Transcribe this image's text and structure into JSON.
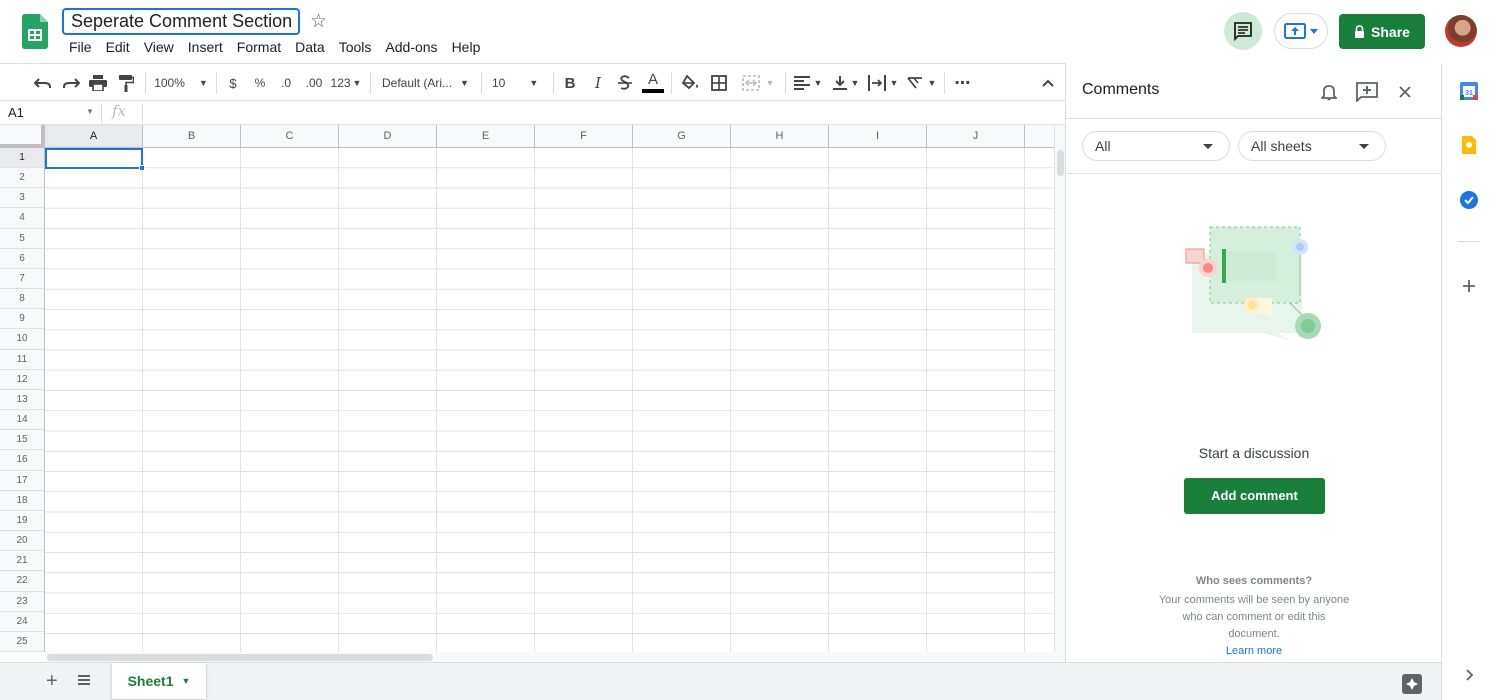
{
  "doc": {
    "title": "Seperate Comment Section"
  },
  "menu": [
    "File",
    "Edit",
    "View",
    "Insert",
    "Format",
    "Data",
    "Tools",
    "Add-ons",
    "Help"
  ],
  "header": {
    "share_label": "Share"
  },
  "toolbar": {
    "zoom": "100%",
    "currency": "$",
    "percent": "%",
    "dec_decrease": ".0",
    "dec_increase": ".00",
    "more_formats": "123",
    "font": "Default (Ari...",
    "font_size": "10",
    "bold": "B",
    "italic": "I",
    "text_color_letter": "A"
  },
  "formula_bar": {
    "name_box": "A1",
    "fx": "fx"
  },
  "grid": {
    "columns": [
      "A",
      "B",
      "C",
      "D",
      "E",
      "F",
      "G",
      "H",
      "I",
      "J"
    ],
    "rows": [
      "1",
      "2",
      "3",
      "4",
      "5",
      "6",
      "7",
      "8",
      "9",
      "10",
      "11",
      "12",
      "13",
      "14",
      "15",
      "16",
      "17",
      "18",
      "19",
      "20",
      "21",
      "22",
      "23",
      "24",
      "25"
    ],
    "selected_cell": "A1"
  },
  "sheets": [
    {
      "name": "Sheet1",
      "active": true
    }
  ],
  "comments_panel": {
    "title": "Comments",
    "filter": "All",
    "scope": "All sheets",
    "empty_title": "Start a discussion",
    "add_button": "Add comment",
    "who_title": "Who sees comments?",
    "who_body": "Your comments will be seen by anyone who can comment or edit this document.",
    "learn_more": "Learn more"
  },
  "colors": {
    "sheets_green": "#188038",
    "selection_blue": "#1a73e8",
    "comment_btn_bg": "#ceead6"
  },
  "icons": [
    "sheets-logo",
    "star-icon",
    "comment-icon",
    "present-icon",
    "lock-icon",
    "undo-icon",
    "redo-icon",
    "print-icon",
    "paint-format-icon",
    "fill-color-icon",
    "borders-icon",
    "merge-icon",
    "align-icon",
    "valign-icon",
    "wrap-icon",
    "rotate-icon",
    "more-icon",
    "collapse-icon",
    "bell-icon",
    "add-comment-icon",
    "close-icon",
    "calendar-icon",
    "keep-icon",
    "tasks-icon",
    "plus-icon",
    "chevron-right-icon",
    "explore-icon"
  ]
}
